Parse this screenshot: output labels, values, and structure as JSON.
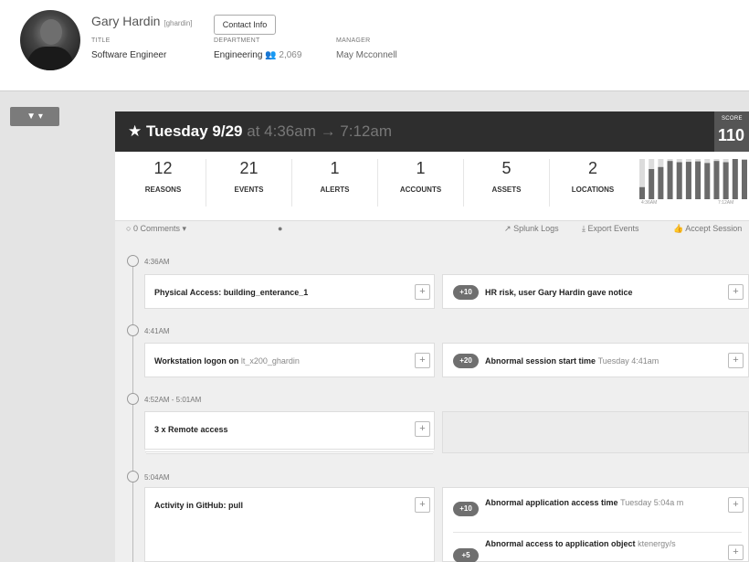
{
  "profile": {
    "name": "Gary Hardin",
    "username": "[ghardin]",
    "contact_label": "Contact Info",
    "title_label": "TITLE",
    "title": "Software Engineer",
    "department_label": "DEPARTMENT",
    "department": "Engineering",
    "dept_count": "2,069",
    "manager_label": "MANAGER",
    "manager": "May Mcconnell"
  },
  "filter": {
    "label": "▼ ▾"
  },
  "session": {
    "date": "Tuesday 9/29",
    "time": "at 4:36am → 7:12am",
    "score_label": "SCORE",
    "score": "110"
  },
  "stats": [
    {
      "n": "12",
      "k": "REASONS"
    },
    {
      "n": "21",
      "k": "EVENTS"
    },
    {
      "n": "1",
      "k": "ALERTS"
    },
    {
      "n": "1",
      "k": "ACCOUNTS"
    },
    {
      "n": "5",
      "k": "ASSETS"
    },
    {
      "n": "2",
      "k": "LOCATIONS"
    }
  ],
  "sparkline": {
    "levels": [
      0.3,
      0.75,
      0.8,
      0.95,
      0.92,
      0.93,
      0.94,
      0.9,
      0.95,
      0.92,
      1.0,
      0.98
    ],
    "start": "4:36AM",
    "end": "7:12AM"
  },
  "footer": {
    "comments": "0 Comments ▾",
    "splunk": "Splunk Logs",
    "export": "Export Events",
    "accept": "Accept Session"
  },
  "timeline": [
    {
      "time": "4:36AM",
      "event": "Physical Access: building_enterance_1",
      "event_extra": "",
      "right": [
        {
          "badge": "+10",
          "text": "HR risk, user Gary Hardin gave notice",
          "extra": ""
        }
      ]
    },
    {
      "time": "4:41AM",
      "event": "Workstation logon on",
      "event_extra": "lt_x200_ghardin",
      "right": [
        {
          "badge": "+20",
          "text": "Abnormal session start time",
          "extra": "Tuesday 4:41am"
        }
      ]
    },
    {
      "time": "4:52AM - 5:01AM",
      "event": "3 x Remote access",
      "event_extra": "",
      "right": []
    },
    {
      "time": "5:04AM",
      "event": "Activity in GitHub: pull",
      "event_extra": "",
      "right": [
        {
          "badge": "+10",
          "text": "Abnormal application access time",
          "extra": "Tuesday 5:04a m"
        },
        {
          "badge": "+5",
          "text": "Abnormal access to application object",
          "extra": "ktenergy/s"
        }
      ]
    }
  ],
  "colors": {
    "accent": "#2e2e2e",
    "badge": "#6f6f6f"
  }
}
